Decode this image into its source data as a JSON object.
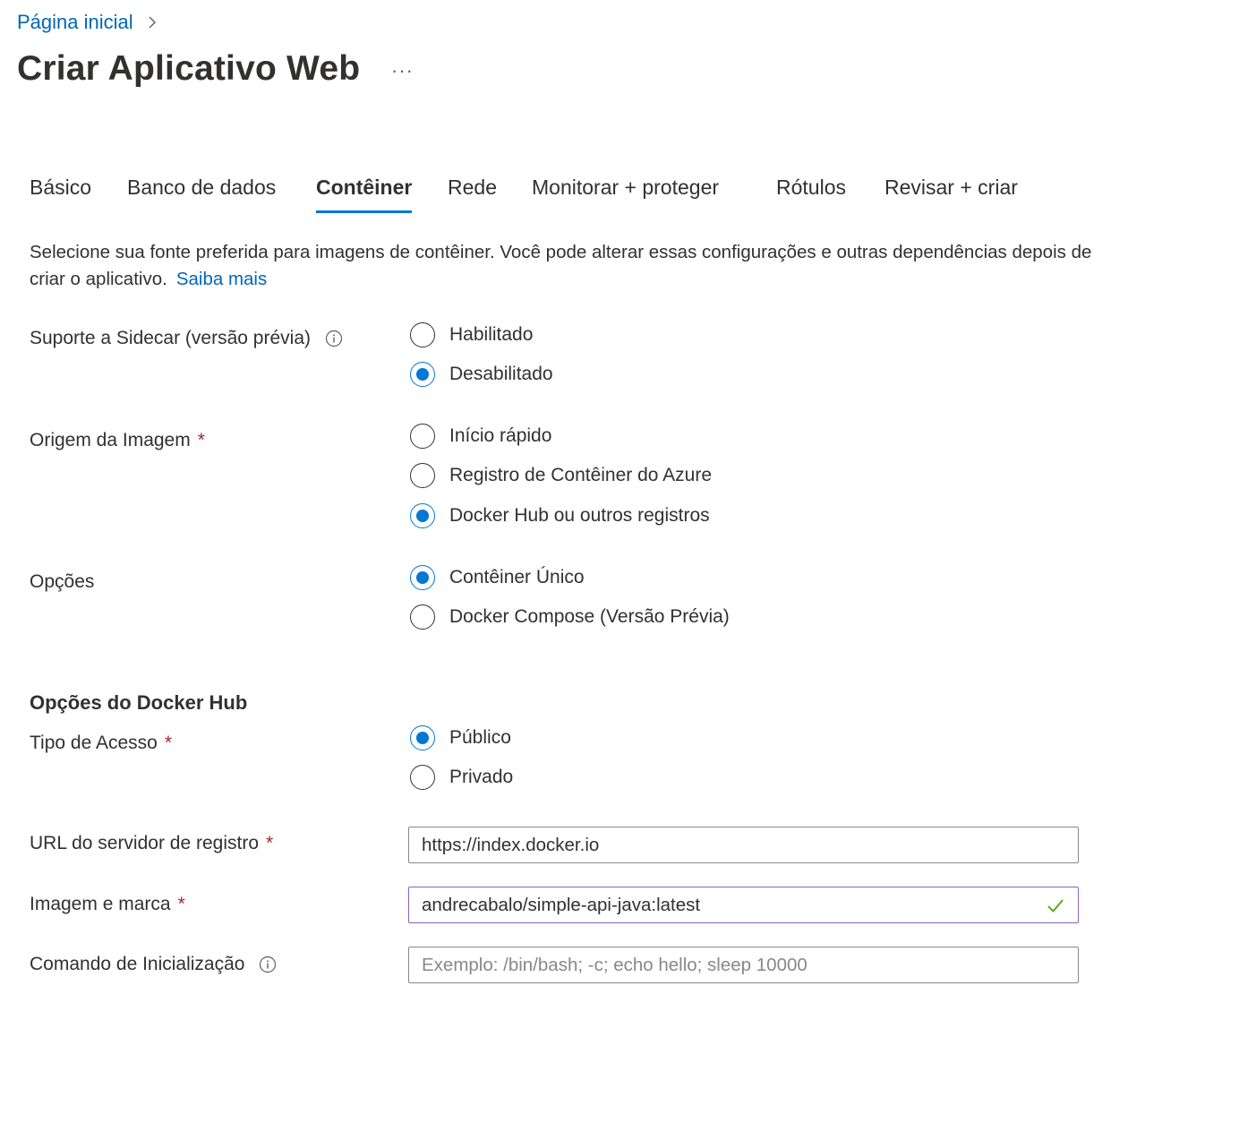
{
  "breadcrumb": {
    "home": "Página inicial"
  },
  "page": {
    "title": "Criar Aplicativo Web",
    "more": "···"
  },
  "tabs": [
    "Básico",
    "Banco de dados",
    "Contêiner",
    "Rede",
    "Monitorar + proteger",
    "Rótulos",
    "Revisar + criar"
  ],
  "active_tab": "Contêiner",
  "intro": {
    "text": "Selecione sua fonte preferida para imagens de contêiner. Você pode alterar essas configurações e outras dependências depois de criar o aplicativo.",
    "link": "Saiba mais"
  },
  "sidecar": {
    "label": "Suporte a Sidecar (versão prévia)",
    "options": [
      "Habilitado",
      "Desabilitado"
    ],
    "selected": "Desabilitado"
  },
  "image_source": {
    "label": "Origem da Imagem",
    "required": "*",
    "options": [
      "Início rápido",
      "Registro de Contêiner do Azure",
      "Docker Hub ou outros registros"
    ],
    "selected": "Docker Hub ou outros registros"
  },
  "options": {
    "label": "Opções",
    "options": [
      "Contêiner Único",
      "Docker Compose (Versão Prévia)"
    ],
    "selected": "Contêiner Único"
  },
  "docker_hub": {
    "heading": "Opções do Docker Hub",
    "access_type": {
      "label": "Tipo de Acesso",
      "required": "*",
      "options": [
        "Público",
        "Privado"
      ],
      "selected": "Público"
    },
    "registry_url": {
      "label": "URL do servidor de registro",
      "required": "*",
      "value": "https://index.docker.io"
    },
    "image_tag": {
      "label": "Imagem e marca",
      "required": "*",
      "value": "andrecabalo/simple-api-java:latest"
    },
    "startup_command": {
      "label": "Comando de Inicialização",
      "value": "",
      "placeholder": "Exemplo: /bin/bash; -c; echo hello; sleep 10000"
    }
  },
  "colors": {
    "accent": "#0078d4",
    "link": "#0067b8",
    "required": "#a4262c",
    "focus_border": "#8764b8",
    "valid_check": "#57a300"
  }
}
